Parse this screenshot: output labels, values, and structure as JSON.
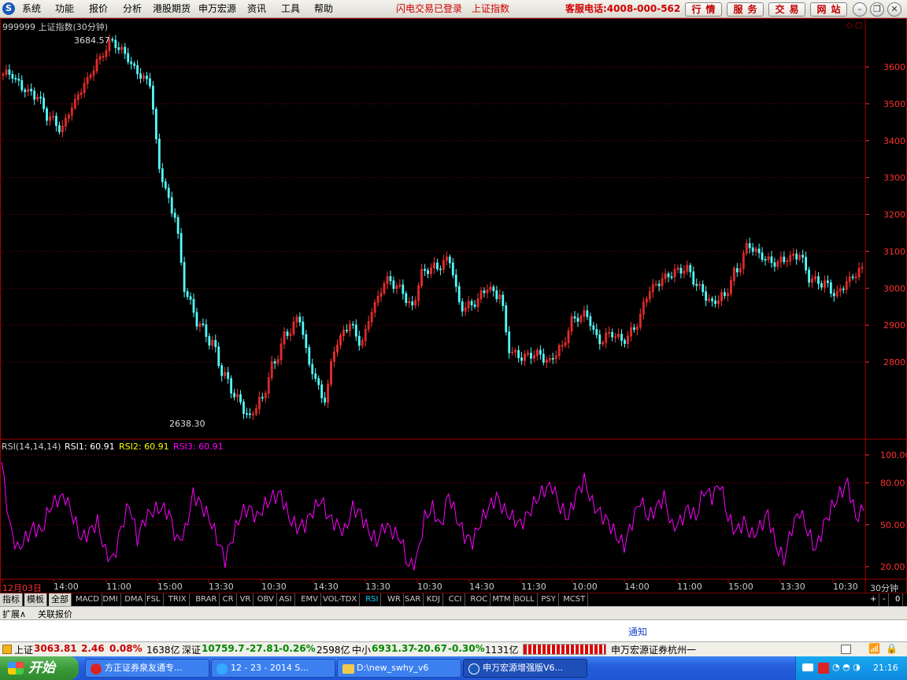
{
  "menubar": {
    "items": [
      "系统",
      "功能",
      "报价",
      "分析",
      "港股期货",
      "申万宏源",
      "资讯",
      "工具",
      "帮助"
    ],
    "status_login": "闪电交易已登录",
    "status_index": "上证指数",
    "hotline": "客服电话:4008-000-562",
    "right_buttons": [
      "行情",
      "服务",
      "交易",
      "网站"
    ]
  },
  "chart_title": "999999 上证指数(30分钟)",
  "chart_data": [
    {
      "type": "candlestick",
      "title": "999999 上证指数(30分钟)",
      "yticks": [
        2800,
        2900,
        3000,
        3100,
        3200,
        3300,
        3400,
        3500,
        3600
      ],
      "ylim": [
        2600,
        3700
      ],
      "annotations": {
        "high": "3684.57",
        "low": "2638.30"
      },
      "close_approx": [
        3580,
        3540,
        3520,
        3460,
        3430,
        3500,
        3560,
        3620,
        3670,
        3640,
        3590,
        3560,
        3300,
        3200,
        2980,
        2900,
        2850,
        2760,
        2700,
        2650,
        2700,
        2800,
        2880,
        2920,
        2780,
        2700,
        2850,
        2900,
        2850,
        2950,
        3020,
        3000,
        2950,
        3050,
        3060,
        3080,
        2950,
        2960,
        3000,
        2980,
        2820,
        2810,
        2820,
        2800,
        2840,
        2920,
        2930,
        2860,
        2880,
        2860,
        2900,
        2990,
        3020,
        3040,
        3050,
        3000,
        2960,
        2980,
        3050,
        3120,
        3090,
        3070,
        3080,
        3090,
        3020,
        3010,
        2980,
        3020,
        3050
      ]
    },
    {
      "type": "line",
      "title": "RSI(14,14,14)",
      "legend": [
        "RSI1: 60.91",
        "RSI2: 60.91",
        "RSI3: 60.91"
      ],
      "yticks": [
        "20.00",
        "50.00",
        "80.00",
        "100.00"
      ],
      "ylim": [
        0,
        110
      ],
      "values_approx": [
        95,
        50,
        32,
        40,
        48,
        45,
        62,
        68,
        70,
        55,
        40,
        45,
        52,
        30,
        25,
        48,
        65,
        40,
        55,
        60,
        62,
        58,
        38,
        45,
        72,
        64,
        55,
        40,
        25,
        42,
        58,
        62,
        55,
        64,
        70,
        72,
        55,
        48,
        50,
        60,
        68,
        55,
        50,
        45,
        62,
        58,
        45,
        38,
        50,
        45,
        40,
        20,
        25,
        55,
        62,
        48,
        72,
        55,
        42,
        38,
        52,
        62,
        70,
        60,
        55,
        50,
        58,
        68,
        75,
        78,
        62,
        55,
        72,
        82,
        65,
        58,
        52,
        42,
        35,
        52,
        68,
        55,
        62,
        70,
        48,
        52,
        62,
        55,
        75,
        70,
        80,
        55,
        45,
        52,
        42,
        48,
        58,
        35,
        25,
        48,
        60,
        45,
        32,
        50,
        62,
        72,
        80,
        55,
        60
      ]
    }
  ],
  "xaxis": {
    "labels": [
      "12月03日",
      "14:00",
      "11:00",
      "15:00",
      "13:30",
      "10:30",
      "14:30",
      "13:30",
      "10:30",
      "14:30",
      "11:30",
      "10:00",
      "14:00",
      "11:00",
      "15:00",
      "13:30",
      "10:30"
    ],
    "period": "30分钟"
  },
  "indicator_tabs": [
    "指标",
    "模板",
    "全部",
    "MACD",
    "DMI",
    "DMA",
    "FSL",
    "TRIX",
    "BRAR",
    "CR",
    "VR",
    "OBV",
    "ASI",
    "EMV",
    "VOL-TDX",
    "RSI",
    "WR",
    "SAR",
    "KDJ",
    "CCI",
    "ROC",
    "MTM",
    "BOLL",
    "PSY",
    "MCST"
  ],
  "indicator_controls": [
    "+",
    "-",
    "0"
  ],
  "sub_tabs": [
    "扩展∧",
    "关联报价"
  ],
  "notice": "通知",
  "quote": {
    "sh_label": "上证",
    "sh_value": "3063.81",
    "sh_change": "2.46",
    "sh_pct": "0.08%",
    "sh_amount": "1638亿",
    "sz_label": "深证",
    "sz_value": "10759.7",
    "sz_change": "-27.81",
    "sz_pct": "-0.26%",
    "sz_amount": "2598亿",
    "zx_label": "中小",
    "zx_value": "6931.37",
    "zx_change": "-20.67",
    "zx_pct": "-0.30%",
    "zx_amount": "1131亿",
    "broker": "申万宏源证券杭州一"
  },
  "taskbar": {
    "start": "开始",
    "tasks": [
      "方正证券泉友通专...",
      "12 - 23 - 2014 S...",
      "D:\\new_swhy_v6",
      "申万宏源增强版V6..."
    ],
    "clock": "21:16"
  },
  "colors": {
    "up": "#ff3232",
    "down": "#54fcfc",
    "rsi": "#ff00ff",
    "grid": "#8b0000",
    "axis": "#a00000"
  }
}
